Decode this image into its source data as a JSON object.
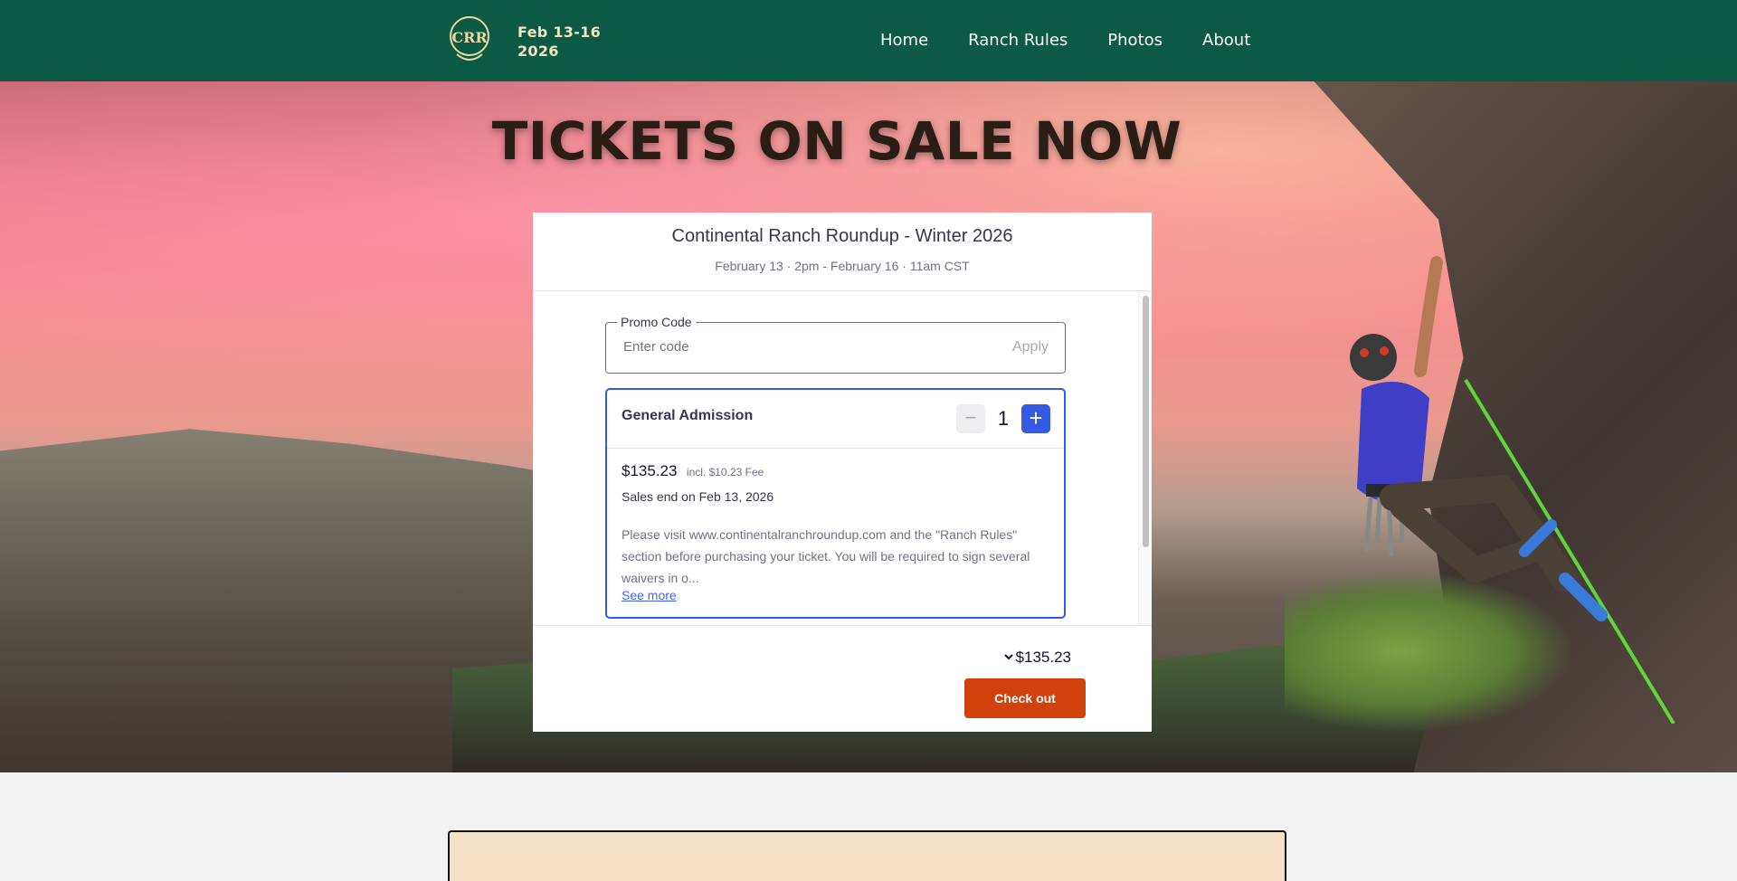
{
  "header": {
    "logo_text": "CRR",
    "dates_line1": "Feb 13-16",
    "dates_line2": "2026",
    "nav": [
      "Home",
      "Ranch Rules",
      "Photos",
      "About"
    ]
  },
  "hero": {
    "title": "TICKETS ON SALE NOW"
  },
  "widget": {
    "event_title": "Continental Ranch Roundup - Winter 2026",
    "event_dates": "February 13 · 2pm - February 16 · 11am CST",
    "promo": {
      "legend": "Promo Code",
      "placeholder": "Enter code",
      "apply_label": "Apply"
    },
    "ticket": {
      "name": "General Admission",
      "minus_icon": "−",
      "quantity": "1",
      "plus_icon": "+",
      "price": "$135.23",
      "fee": "incl. $10.23 Fee",
      "sales_end": "Sales end on Feb 13, 2026",
      "description": "Please visit www.continentalranchroundup.com and the \"Ranch Rules\" section before purchasing your ticket.  You will be required to sign several waivers in o...",
      "see_more": "See more"
    },
    "footer": {
      "total": "$135.23",
      "checkout_label": "Check out"
    }
  },
  "colors": {
    "header_bg": "#0c5a43",
    "accent_blue": "#3659e3",
    "checkout_orange": "#d1410c",
    "panel_bg": "#f5e2c6"
  }
}
